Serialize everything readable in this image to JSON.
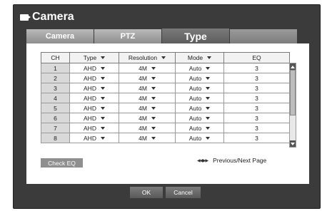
{
  "window": {
    "title": "Camera",
    "title_icon": "camera-icon"
  },
  "tabs": [
    "Camera",
    "PTZ",
    "Type",
    ""
  ],
  "active_tab": "Type",
  "table": {
    "headers": [
      "CH",
      "Type",
      "Resolution",
      "Mode",
      "EQ"
    ],
    "rows": [
      {
        "ch": "1",
        "type": "AHD",
        "resolution": "4M",
        "mode": "Auto",
        "eq": "3"
      },
      {
        "ch": "2",
        "type": "AHD",
        "resolution": "4M",
        "mode": "Auto",
        "eq": "3"
      },
      {
        "ch": "3",
        "type": "AHD",
        "resolution": "4M",
        "mode": "Auto",
        "eq": "3"
      },
      {
        "ch": "4",
        "type": "AHD",
        "resolution": "4M",
        "mode": "Auto",
        "eq": "3"
      },
      {
        "ch": "5",
        "type": "AHD",
        "resolution": "4M",
        "mode": "Auto",
        "eq": "3"
      },
      {
        "ch": "6",
        "type": "AHD",
        "resolution": "4M",
        "mode": "Auto",
        "eq": "3"
      },
      {
        "ch": "7",
        "type": "AHD",
        "resolution": "4M",
        "mode": "Auto",
        "eq": "3"
      },
      {
        "ch": "8",
        "type": "AHD",
        "resolution": "4M",
        "mode": "Auto",
        "eq": "3"
      }
    ]
  },
  "buttons": {
    "check_eq": "Check EQ",
    "ok": "OK",
    "cancel": "Cancel"
  },
  "pager": {
    "label": "Previous/Next Page",
    "icon": "prev-next-arrows-icon"
  },
  "colors": {
    "window_bg": "#3b3b3b",
    "panel_bg": "#ffffff",
    "active_tab": "#666666",
    "inactive_tab": "#a8a8a8"
  }
}
